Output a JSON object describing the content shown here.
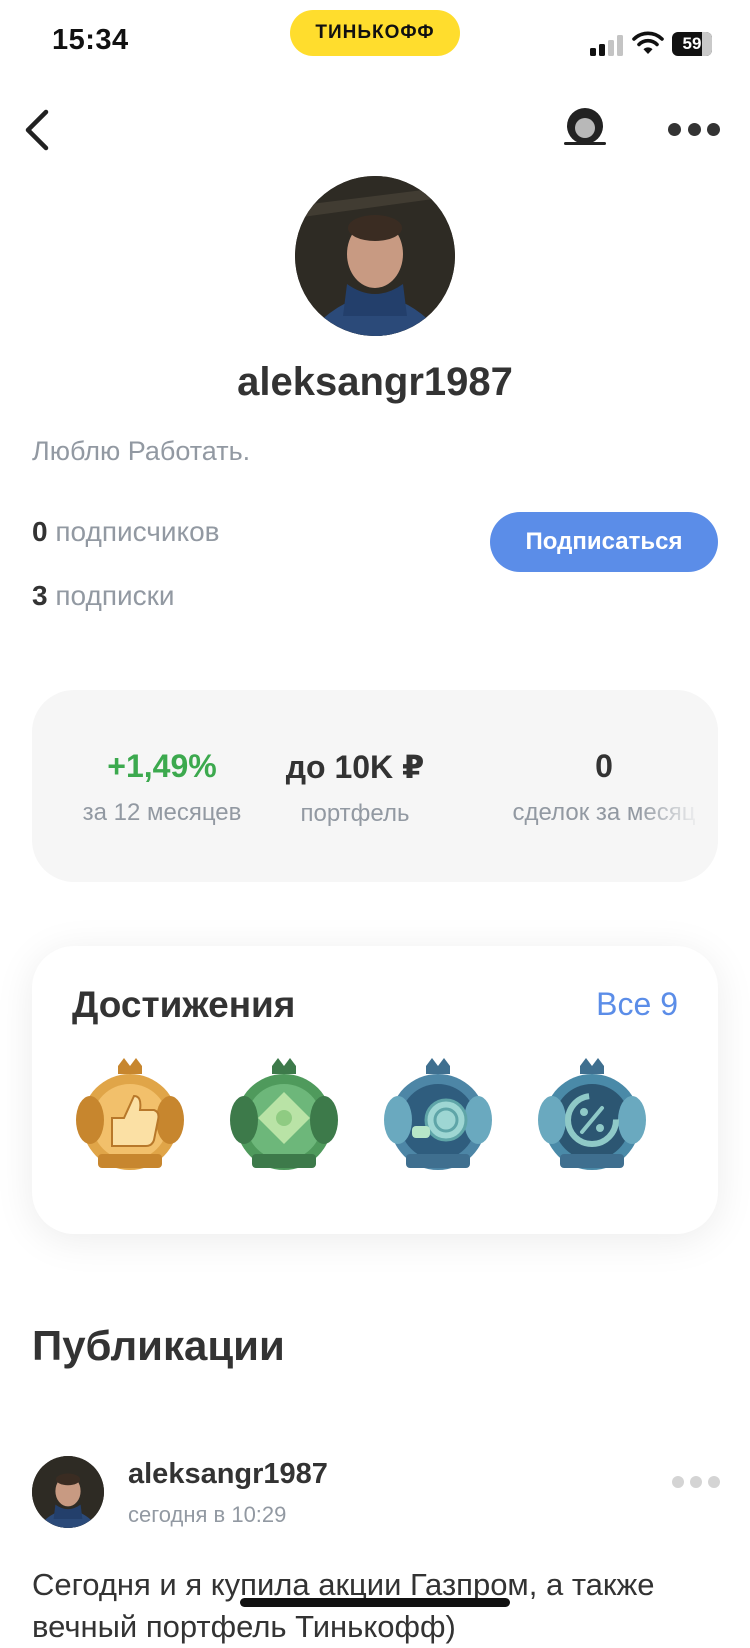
{
  "status_bar": {
    "time": "15:34",
    "brand": "ТИНЬКОФФ",
    "battery": "59"
  },
  "nav": {
    "back_icon": "chevron-left-icon",
    "mask_icon": "mask-icon",
    "more_icon": "more-dots-icon"
  },
  "profile": {
    "username": "aleksangr1987",
    "bio": "Люблю Работать.",
    "followers_count": "0",
    "followers_label": "подписчиков",
    "following_count": "3",
    "following_label": "подписки",
    "subscribe_label": "Подписаться"
  },
  "stats": [
    {
      "value": "+1,49%",
      "label": "за 12 месяцев",
      "color": "#3ca94e"
    },
    {
      "value": "до 10K ₽",
      "label": "портфель"
    },
    {
      "value": "0",
      "label": "сделок за месяц"
    }
  ],
  "achievements": {
    "title": "Достижения",
    "all_label": "Все 9",
    "badges": [
      {
        "icon": "thumbs-up-badge-icon",
        "color": "#d99a3f"
      },
      {
        "icon": "puzzle-badge-icon",
        "color": "#4f9a5c"
      },
      {
        "icon": "coins-badge-icon",
        "color": "#5d9cb4"
      },
      {
        "icon": "percent-badge-icon",
        "color": "#4a8aa8"
      }
    ]
  },
  "publications": {
    "title": "Публикации",
    "post": {
      "author": "aleksangr1987",
      "time": "сегодня в 10:29",
      "text": "Сегодня и я купила акции Газпром, а также вечный портфель Тинькофф)"
    }
  },
  "colors": {
    "accent": "#5b8de8",
    "brand_yellow": "#FFDD2D",
    "positive": "#3ca94e"
  }
}
